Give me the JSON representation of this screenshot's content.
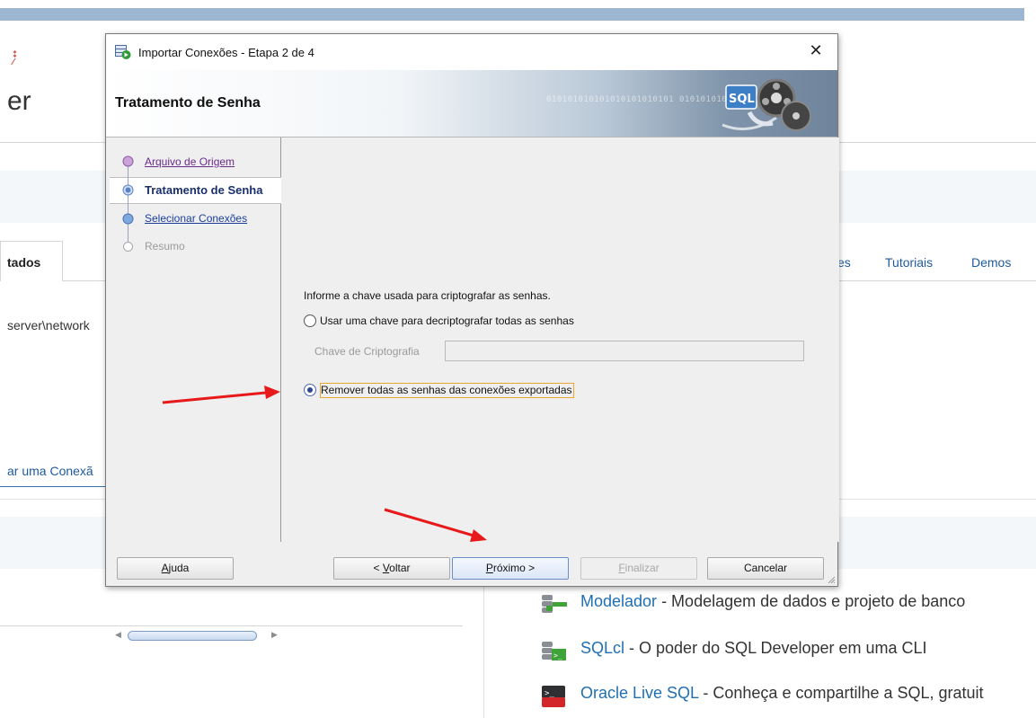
{
  "background": {
    "page_title_fragment": "er",
    "tab_fragment": "tados",
    "nav_links": [
      "es",
      "Tutoriais",
      "Demos"
    ],
    "server_path": "server\\network",
    "conexao_link": "ar uma Conexã",
    "products": [
      {
        "icon": "data-modeler-icon",
        "name": "Modelador",
        "desc": " - Modelagem de dados e projeto de banco"
      },
      {
        "icon": "sqlcl-icon",
        "name": "SQLcl",
        "desc": " - O poder do SQL Developer em uma CLI"
      },
      {
        "icon": "live-sql-icon",
        "name": "Oracle Live SQL",
        "desc": " - Conheça e compartilhe a SQL, gratuit"
      }
    ]
  },
  "dialog": {
    "title": "Importar Conexões - Etapa 2 de 4",
    "close_glyph": "✕",
    "banner_title": "Tratamento de Senha",
    "banner_binary": "010101010101010101010101 01010101010",
    "steps": [
      {
        "label": "Arquivo de Origem",
        "state": "visited"
      },
      {
        "label": "Tratamento de Senha",
        "state": "current"
      },
      {
        "label": "Selecionar Conexões",
        "state": "link"
      },
      {
        "label": "Resumo",
        "state": "disabled"
      }
    ],
    "prompt": "Informe a chave usada para criptografar as senhas.",
    "option_use_key": "Usar uma chave para decriptografar todas as senhas",
    "key_label": "Chave de Criptografia",
    "key_value": "",
    "option_remove": "Remover todas as senhas das conexões exportadas",
    "selected_option": "remove",
    "buttons": {
      "help_mnemonic": "A",
      "help_rest": "juda",
      "back_prefix": "< ",
      "back_mnemonic": "V",
      "back_rest": "oltar",
      "next_mnemonic": "P",
      "next_rest": "róximo >",
      "finish_mnemonic": "F",
      "finish_rest": "inalizar",
      "cancel": "Cancelar"
    },
    "accent_color": "#e8a531"
  },
  "annotations": {
    "arrow_color": "#e8191a"
  }
}
